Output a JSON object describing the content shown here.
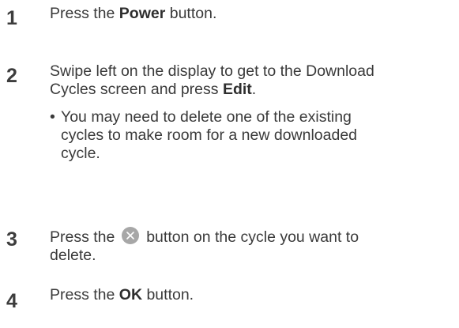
{
  "steps": [
    {
      "number": "1",
      "pre": "Press the ",
      "bold": "Power",
      "post": " button."
    },
    {
      "number": "2",
      "line1": "Swipe left on the display to get to the Download",
      "line2_pre": "Cycles screen and press ",
      "line2_bold": "Edit",
      "line2_post": ".",
      "bullet": "•",
      "sub_line1": "You may need to delete one of the existing",
      "sub_line2": "cycles to make room for a new downloaded",
      "sub_line3": "cycle."
    },
    {
      "number": "3",
      "pre": "Press the ",
      "icon": "close-x-circle-icon",
      "post": " button on the cycle you want to",
      "line2": "delete."
    },
    {
      "number": "4",
      "pre": "Press the ",
      "bold": "OK",
      "post": " button."
    }
  ]
}
